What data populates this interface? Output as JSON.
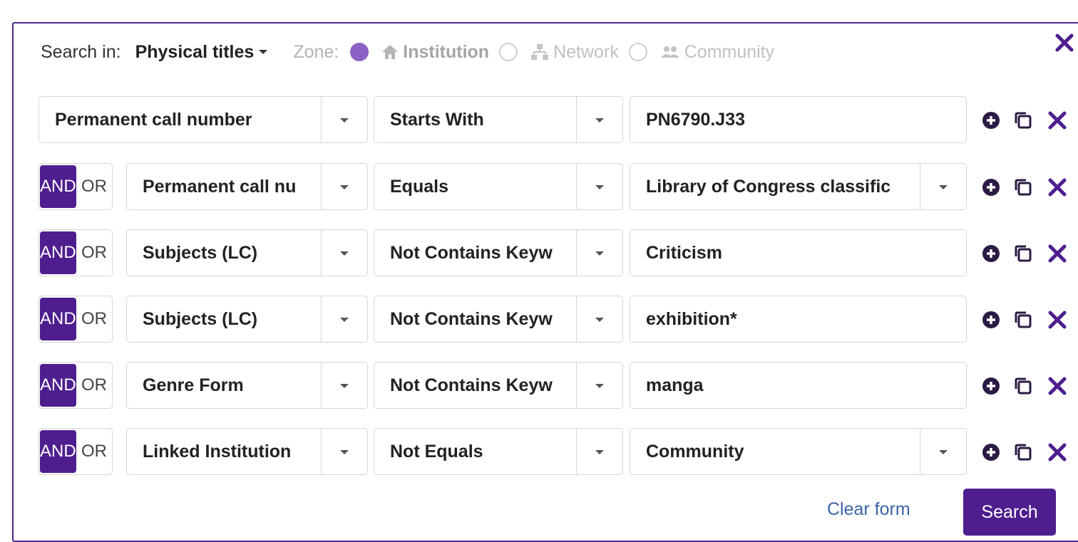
{
  "header": {
    "search_in_label": "Search in:",
    "scope_value": "Physical titles",
    "zone_label": "Zone:",
    "zones": [
      {
        "label": "Institution",
        "icon": "home-icon",
        "selected": true
      },
      {
        "label": "Network",
        "icon": "network-icon",
        "selected": false
      },
      {
        "label": "Community",
        "icon": "users-icon",
        "selected": false
      }
    ]
  },
  "rows": [
    {
      "operator": null,
      "field": "Permanent call number",
      "condition": "Starts With",
      "value": "PN6790.J33",
      "value_is_dropdown": false
    },
    {
      "operator": "AND",
      "field": "Permanent call nu",
      "condition": "Equals",
      "value": "Library of Congress classific",
      "value_is_dropdown": true
    },
    {
      "operator": "AND",
      "field": "Subjects (LC)",
      "condition": "Not Contains Keyw",
      "value": "Criticism",
      "value_is_dropdown": false
    },
    {
      "operator": "AND",
      "field": "Subjects (LC)",
      "condition": "Not Contains Keyw",
      "value": "exhibition*",
      "value_is_dropdown": false
    },
    {
      "operator": "AND",
      "field": "Genre Form",
      "condition": "Not Contains Keyw",
      "value": "manga",
      "value_is_dropdown": false
    },
    {
      "operator": "AND",
      "field": "Linked Institution",
      "condition": "Not Equals",
      "value": "Community",
      "value_is_dropdown": true
    }
  ],
  "operator_labels": {
    "and": "AND",
    "or": "OR"
  },
  "footer": {
    "clear_label": "Clear form",
    "search_label": "Search"
  },
  "colors": {
    "primary": "#4e1e8f",
    "radio_selected": "#8c63c4",
    "link": "#3b63a8",
    "border": "#d6d6d6"
  }
}
